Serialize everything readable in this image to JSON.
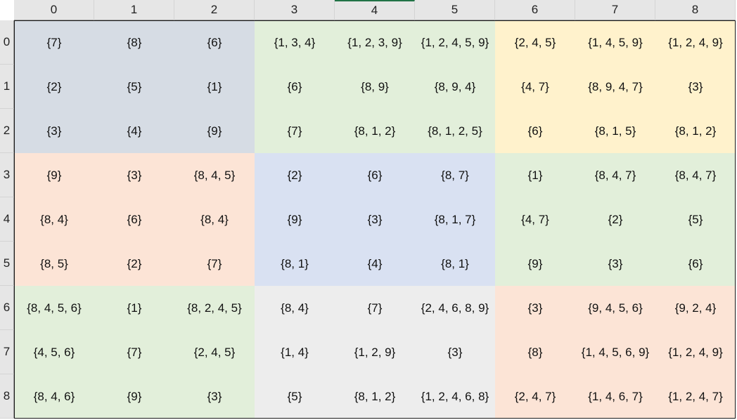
{
  "columns": [
    "0",
    "1",
    "2",
    "3",
    "4",
    "5",
    "6",
    "7",
    "8"
  ],
  "rows": [
    "0",
    "1",
    "2",
    "3",
    "4",
    "5",
    "6",
    "7",
    "8"
  ],
  "box_colors": [
    [
      "#d6dce4",
      "#e2efda",
      "#fff2cc"
    ],
    [
      "#fce4d6",
      "#d9e1f2",
      "#e2efda"
    ],
    [
      "#e2efda",
      "#ededed",
      "#fce4d6"
    ]
  ],
  "cells": [
    [
      "{7}",
      "{8}",
      "{6}",
      "{1, 3, 4}",
      "{1, 2, 3, 9}",
      "{1, 2, 4, 5, 9}",
      "{2, 4, 5}",
      "{1, 4, 5, 9}",
      "{1, 2, 4, 9}"
    ],
    [
      "{2}",
      "{5}",
      "{1}",
      "{6}",
      "{8, 9}",
      "{8, 9, 4}",
      "{4, 7}",
      "{8, 9, 4, 7}",
      "{3}"
    ],
    [
      "{3}",
      "{4}",
      "{9}",
      "{7}",
      "{8, 1, 2}",
      "{8, 1, 2, 5}",
      "{6}",
      "{8, 1, 5}",
      "{8, 1, 2}"
    ],
    [
      "{9}",
      "{3}",
      "{8, 4, 5}",
      "{2}",
      "{6}",
      "{8, 7}",
      "{1}",
      "{8, 4, 7}",
      "{8, 4, 7}"
    ],
    [
      "{8, 4}",
      "{6}",
      "{8, 4}",
      "{9}",
      "{3}",
      "{8, 1, 7}",
      "{4, 7}",
      "{2}",
      "{5}"
    ],
    [
      "{8, 5}",
      "{2}",
      "{7}",
      "{8, 1}",
      "{4}",
      "{8, 1}",
      "{9}",
      "{3}",
      "{6}"
    ],
    [
      "{8, 4, 5, 6}",
      "{1}",
      "{8, 2, 4, 5}",
      "{8, 4}",
      "{7}",
      "{2, 4, 6, 8, 9}",
      "{3}",
      "{9, 4, 5, 6}",
      "{9, 2, 4}"
    ],
    [
      "{4, 5, 6}",
      "{7}",
      "{2, 4, 5}",
      "{1, 4}",
      "{1, 2, 9}",
      "{3}",
      "{8}",
      "{1, 4, 5, 6, 9}",
      "{1, 2, 4, 9}"
    ],
    [
      "{8, 4, 6}",
      "{9}",
      "{3}",
      "{5}",
      "{8, 1, 2}",
      "{1, 2, 4, 6, 8}",
      "{2, 4, 7}",
      "{1, 4, 6, 7}",
      "{1, 2, 4, 7}"
    ]
  ]
}
